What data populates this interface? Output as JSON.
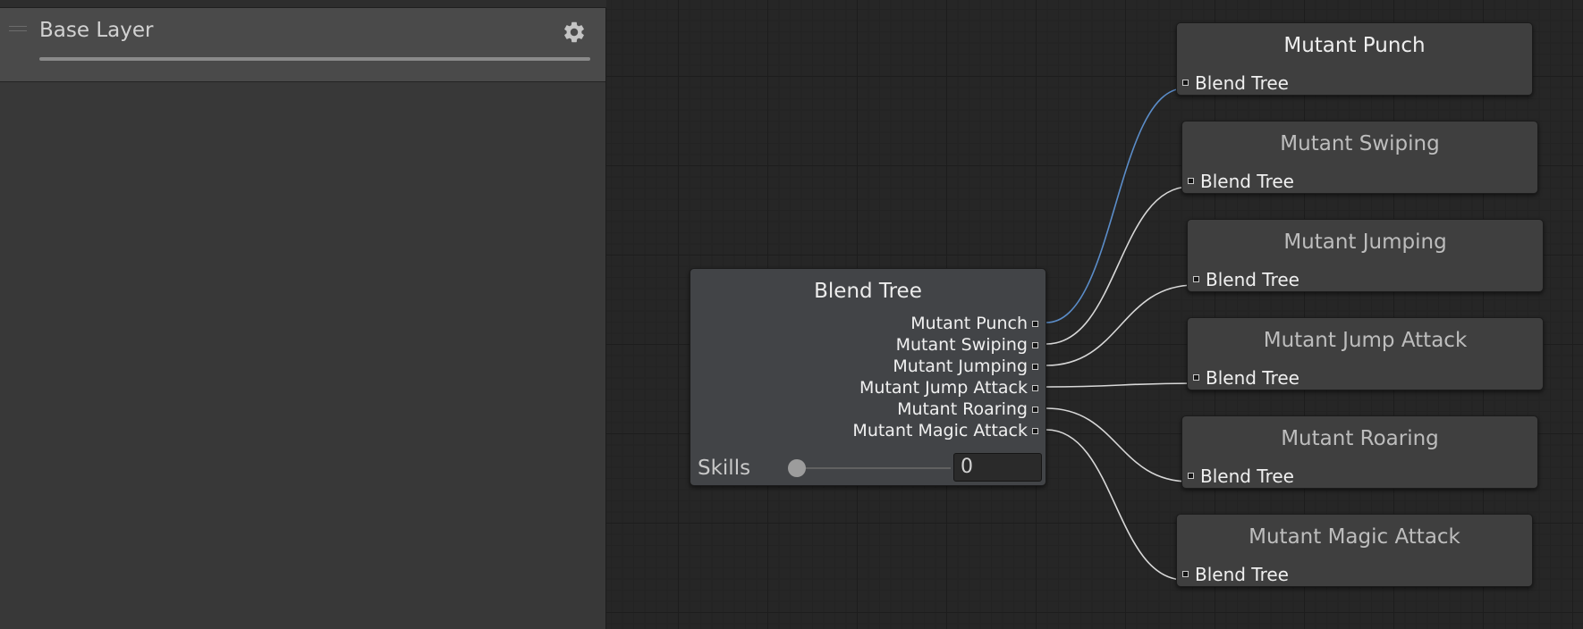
{
  "layers_panel": {
    "layer_name": "Base Layer",
    "icons": {
      "settings": "gear-icon",
      "drag_handle": "drag-handle-icon"
    }
  },
  "blend_tree": {
    "title": "Blend Tree",
    "outputs": [
      "Mutant Punch",
      "Mutant Swiping",
      "Mutant Jumping",
      "Mutant Jump Attack",
      "Mutant Roaring",
      "Mutant Magic Attack"
    ],
    "parameter": {
      "label": "Skills",
      "value": "0",
      "slider_fraction": 0
    }
  },
  "motion_nodes": [
    {
      "title": "Mutant Punch",
      "input_label": "Blend Tree",
      "selected_link": true
    },
    {
      "title": "Mutant Swiping",
      "input_label": "Blend Tree",
      "selected_link": false
    },
    {
      "title": "Mutant Jumping",
      "input_label": "Blend Tree",
      "selected_link": false
    },
    {
      "title": "Mutant Jump Attack",
      "input_label": "Blend Tree",
      "selected_link": false
    },
    {
      "title": "Mutant Roaring",
      "input_label": "Blend Tree",
      "selected_link": false
    },
    {
      "title": "Mutant Magic Attack",
      "input_label": "Blend Tree",
      "selected_link": false
    }
  ],
  "colors": {
    "graph_background": "#262626",
    "node_background": "#3f3f3f",
    "wire": "#d8d8d8",
    "selected_wire": "#5b8dc9"
  }
}
